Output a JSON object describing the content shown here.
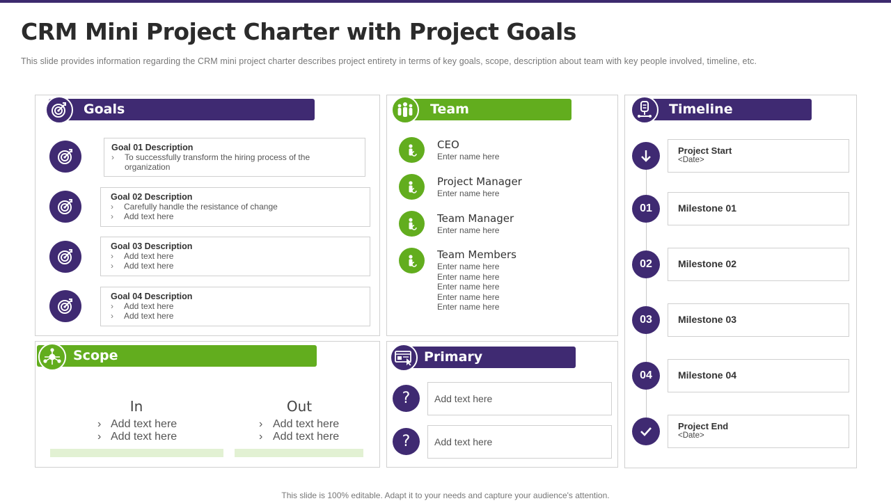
{
  "page": {
    "title": "CRM Mini Project Charter with Project Goals",
    "subtitle": "This slide provides  information  regarding  the  CRM  mini  project  charter  describes  project  entirety  in  terms  of  key  goals,  scope,  description  about  team  with  key  people  involved,   timeline,  etc.",
    "footer": "This slide is 100% editable. Adapt it to your needs and capture your audience's attention."
  },
  "goals": {
    "header": "Goals",
    "items": [
      {
        "title": "Goal 01 Description",
        "lines": [
          "To successfully transform the hiring process of the organization"
        ]
      },
      {
        "title": "Goal 02 Description",
        "lines": [
          "Carefully handle the resistance of change",
          "Add text here"
        ]
      },
      {
        "title": "Goal 03 Description",
        "lines": [
          "Add text here",
          "Add text here"
        ]
      },
      {
        "title": "Goal 04 Description",
        "lines": [
          "Add text here",
          "Add text here"
        ]
      }
    ]
  },
  "team": {
    "header": "Team",
    "members": [
      {
        "role": "CEO",
        "names": [
          "Enter name here"
        ]
      },
      {
        "role": "Project Manager",
        "names": [
          "Enter name here"
        ]
      },
      {
        "role": "Team Manager",
        "names": [
          "Enter name here"
        ]
      },
      {
        "role": "Team Members",
        "names": [
          "Enter name here",
          "Enter name here",
          "Enter name here",
          "Enter name here",
          "Enter name here"
        ]
      }
    ]
  },
  "timeline": {
    "header": "Timeline",
    "items": [
      {
        "marker": "arrow-down-icon",
        "label": "Project Start",
        "sub": "<Date>"
      },
      {
        "marker": "01",
        "label": "Milestone 01"
      },
      {
        "marker": "02",
        "label": "Milestone 02"
      },
      {
        "marker": "03",
        "label": "Milestone 03"
      },
      {
        "marker": "04",
        "label": "Milestone 04"
      },
      {
        "marker": "check-icon",
        "label": "Project End",
        "sub": "<Date>"
      }
    ]
  },
  "scope": {
    "header": "Scope",
    "in": {
      "heading": "In",
      "items": [
        "Add text here",
        "Add text here"
      ]
    },
    "out": {
      "heading": "Out",
      "items": [
        "Add text here",
        "Add text here"
      ]
    }
  },
  "primary": {
    "header": "Primary",
    "items": [
      {
        "icon": "question-icon",
        "text": "Add text here"
      },
      {
        "icon": "question-icon",
        "text": "Add text here"
      }
    ]
  },
  "colors": {
    "purple": "#3f2a72",
    "green": "#62ad1e",
    "light_green": "#e2f1d3"
  },
  "bullet": "›"
}
